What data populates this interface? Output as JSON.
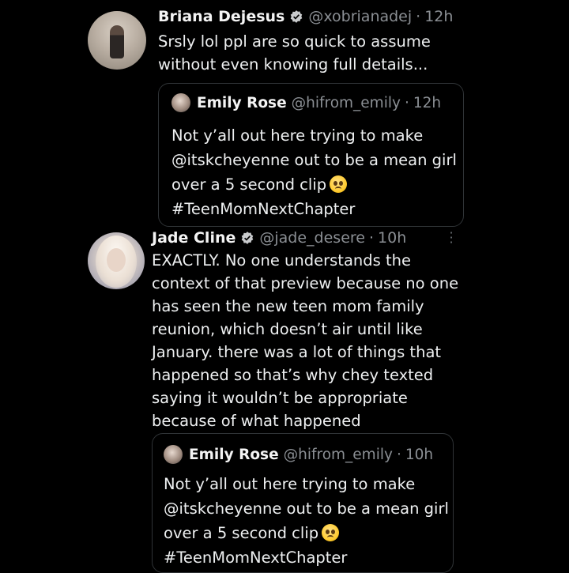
{
  "tweets": [
    {
      "name": "Briana Dejesus",
      "handle": "@xobrianadej",
      "separator": "·",
      "time": "12h",
      "text_lines": [
        "Srsly lol ppl are so quick to assume",
        "without even knowing full details..."
      ],
      "verified": true,
      "avatar_icon": "profile-photo",
      "quote": {
        "name": "Emily Rose",
        "handle": "@hifrom_emily",
        "separator": "·",
        "time": "12h",
        "text_lines": [
          "Not y’all out here trying to make",
          "@itskcheyenne out to be a mean girl",
          "over a 5 second clip",
          "#TeenMomNextChapter"
        ],
        "emoji": "pleading-face"
      }
    },
    {
      "name": "Jade Cline",
      "handle": "@jade_desere",
      "separator": "·",
      "time": "10h",
      "text_lines": [
        "EXACTLY. No one understands the",
        "context of that preview because no one",
        "has seen the new teen mom family",
        "reunion, which doesn’t air until like",
        "January. there was a lot of things that",
        "happened so that’s why chey texted",
        "saying it wouldn’t be appropriate",
        "because of what happened"
      ],
      "verified": true,
      "avatar_icon": "profile-photo",
      "more_icon": "more-vertical-icon",
      "quote": {
        "name": "Emily Rose",
        "handle": "@hifrom_emily",
        "separator": "·",
        "time": "10h",
        "text_lines": [
          "Not y’all out here trying to make",
          "@itskcheyenne out to be a mean girl",
          "over a 5 second clip",
          "#TeenMomNextChapter"
        ],
        "emoji": "pleading-face"
      }
    }
  ],
  "colors": {
    "background": "#000000",
    "text": "#e7e9ea",
    "muted": "#8b8f94",
    "verified": "#c9cbcd",
    "border": "#2f3336"
  }
}
